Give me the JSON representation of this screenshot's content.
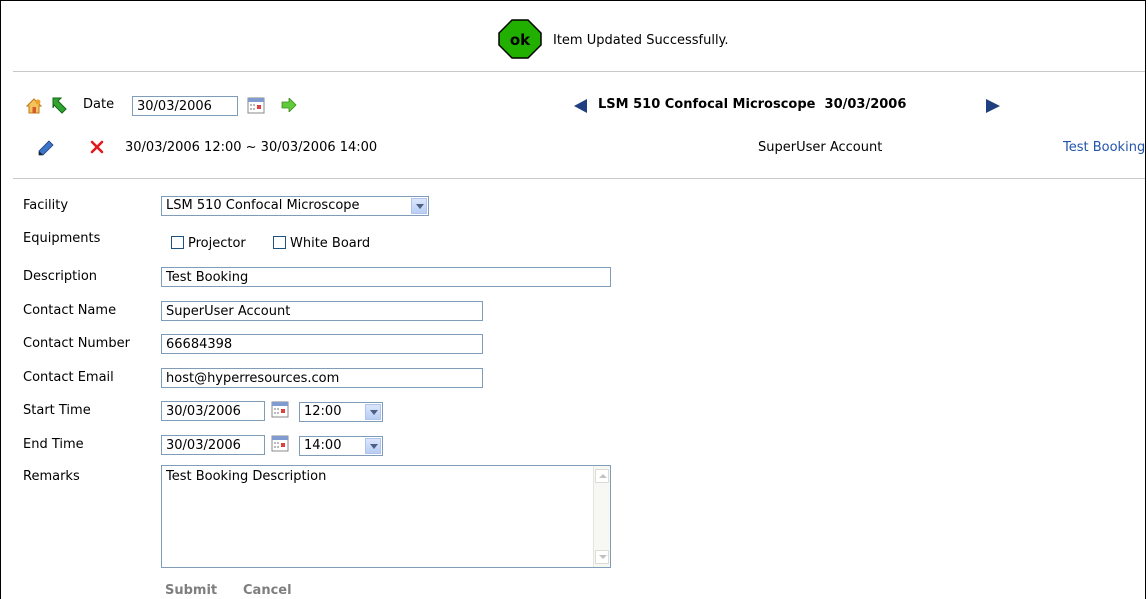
{
  "banner": {
    "badge_text": "ok",
    "message": "Item Updated Successfully."
  },
  "toolbar": {
    "home_icon": "home-icon",
    "back_icon": "green-back-arrow-icon",
    "date_label": "Date",
    "date_value": "30/03/2006",
    "calendar_icon": "calendar-icon",
    "go_icon": "green-forward-arrow-icon"
  },
  "nav": {
    "title": "LSM 510 Confocal Microscope  30/03/2006",
    "prev_icon": "left-triangle-icon",
    "next_icon": "right-triangle-icon"
  },
  "booking_row": {
    "edit_icon": "pencil-icon",
    "delete_icon": "red-x-icon",
    "time_range": "30/03/2006 12:00 ~ 30/03/2006 14:00",
    "user": "SuperUser Account",
    "booking_link": "Test Booking"
  },
  "form": {
    "facility_label": "Facility",
    "facility_value": "LSM 510 Confocal Microscope",
    "equipments_label": "Equipments",
    "equipment_options": [
      "Projector",
      "White Board"
    ],
    "description_label": "Description",
    "description_value": "Test Booking",
    "contact_name_label": "Contact Name",
    "contact_name_value": "SuperUser Account",
    "contact_number_label": "Contact Number",
    "contact_number_value": "66684398",
    "contact_email_label": "Contact Email",
    "contact_email_value": "host@hyperresources.com",
    "start_time_label": "Start Time",
    "start_date_value": "30/03/2006",
    "start_time_value": "12:00",
    "end_time_label": "End Time",
    "end_date_value": "30/03/2006",
    "end_time_value": "14:00",
    "remarks_label": "Remarks",
    "remarks_value": "Test Booking Description",
    "submit_label": "Submit",
    "cancel_label": "Cancel"
  },
  "colors": {
    "ok_green": "#22b000",
    "link_blue": "#2255aa",
    "nav_arrow": "#203f80",
    "input_border": "#7f9db9"
  }
}
